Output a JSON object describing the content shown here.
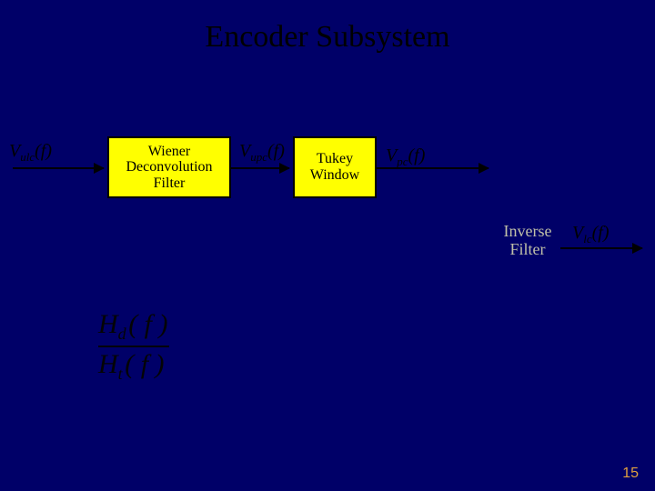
{
  "title": "Encoder Subsystem",
  "signals": {
    "vulc": {
      "main": "V",
      "sub": "ulc",
      "tail": "(f)"
    },
    "vupc": {
      "main": "V",
      "sub": "upc",
      "tail": "(f)"
    },
    "vpc": {
      "main": "V",
      "sub": "pc",
      "tail": "(f)"
    },
    "vlc": {
      "main": "V",
      "sub": "lc",
      "tail": "(f)"
    }
  },
  "blocks": {
    "wiener": {
      "l1": "Wiener",
      "l2": "Deconvolution",
      "l3": "Filter"
    },
    "tukey": {
      "l1": "Tukey",
      "l2": "Window"
    },
    "inverse": {
      "l1": "Inverse",
      "l2": "Filter"
    }
  },
  "fraction": {
    "num_main": "H",
    "num_sub": "d",
    "num_tail": "( f )",
    "den_main": "H",
    "den_sub": "t",
    "den_tail": "( f )"
  },
  "pagenum": "15"
}
